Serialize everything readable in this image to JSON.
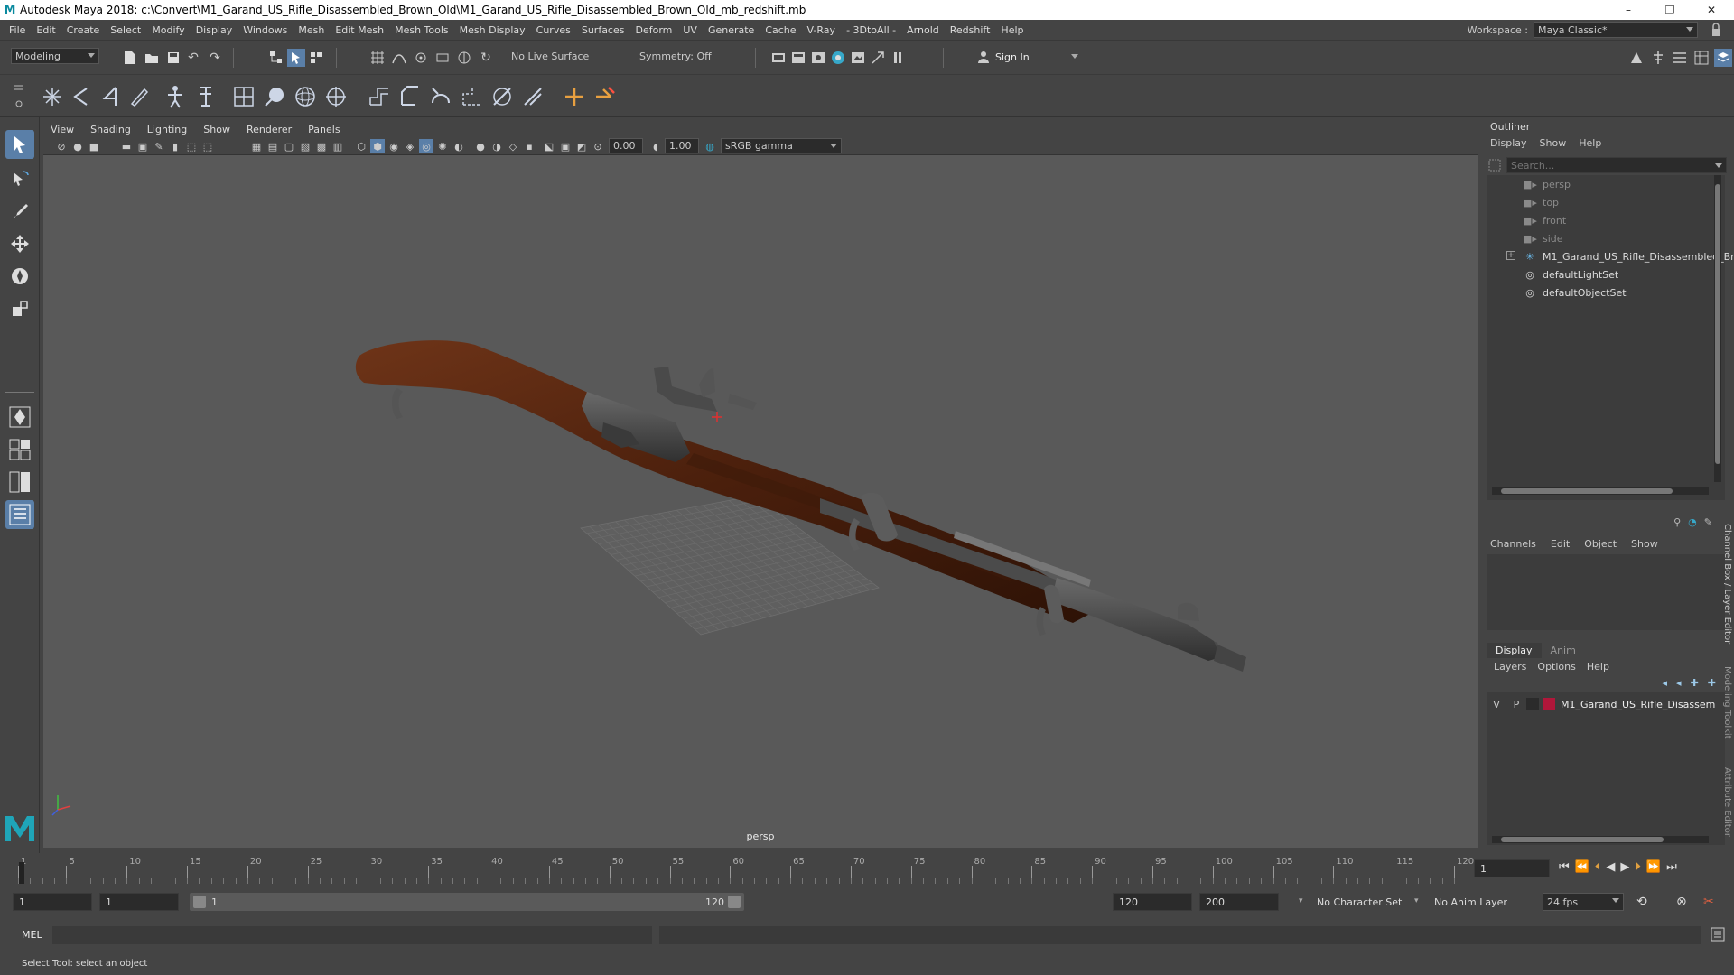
{
  "window": {
    "title": "Autodesk Maya 2018: c:\\Convert\\M1_Garand_US_Rifle_Disassembled_Brown_Old\\M1_Garand_US_Rifle_Disassembled_Brown_Old_mb_redshift.mb",
    "logo": "M",
    "controls": [
      "–",
      "❐",
      "✕"
    ]
  },
  "menubar": {
    "items": [
      "File",
      "Edit",
      "Create",
      "Select",
      "Modify",
      "Display",
      "Windows",
      "Mesh",
      "Edit Mesh",
      "Mesh Tools",
      "Mesh Display",
      "Curves",
      "Surfaces",
      "Deform",
      "UV",
      "Generate",
      "Cache",
      "V-Ray",
      "- 3DtoAll -",
      "Arnold",
      "Redshift",
      "Help"
    ],
    "workspace_label": "Workspace :",
    "workspace_value": "Maya Classic*"
  },
  "statusline": {
    "mode": "Modeling",
    "live_surface": "No Live Surface",
    "symmetry": "Symmetry: Off",
    "sign_in": "Sign In"
  },
  "viewport": {
    "menus": [
      "View",
      "Shading",
      "Lighting",
      "Show",
      "Renderer",
      "Panels"
    ],
    "exposure": "0.00",
    "gamma": "1.00",
    "color_space": "sRGB gamma",
    "camera_label": "persp"
  },
  "outliner": {
    "title": "Outliner",
    "menus": [
      "Display",
      "Show",
      "Help"
    ],
    "search_placeholder": "Search...",
    "items": [
      {
        "label": "persp",
        "icon": "camera-icon",
        "dim": true
      },
      {
        "label": "top",
        "icon": "camera-icon",
        "dim": true
      },
      {
        "label": "front",
        "icon": "camera-icon",
        "dim": true
      },
      {
        "label": "side",
        "icon": "camera-icon",
        "dim": true
      },
      {
        "label": "M1_Garand_US_Rifle_Disassembled_Bro",
        "icon": "group-icon",
        "dim": false
      },
      {
        "label": "defaultLightSet",
        "icon": "set-icon",
        "dim": false
      },
      {
        "label": "defaultObjectSet",
        "icon": "set-icon",
        "dim": false
      }
    ]
  },
  "channelbox": {
    "menus": [
      "Channels",
      "Edit",
      "Object",
      "Show"
    ]
  },
  "layers": {
    "tabs": [
      "Display",
      "Anim"
    ],
    "menus": [
      "Layers",
      "Options",
      "Help"
    ],
    "rows": [
      {
        "v": "V",
        "p": "P",
        "name": "M1_Garand_US_Rifle_Disassem",
        "color": "#b0173a"
      }
    ]
  },
  "side_tabs": [
    "Channel Box / Layer Editor",
    "Modeling Toolkit",
    "Attribute Editor"
  ],
  "timeline": {
    "ticks": [
      "1",
      "5",
      "10",
      "15",
      "20",
      "25",
      "30",
      "35",
      "40",
      "45",
      "50",
      "55",
      "60",
      "65",
      "70",
      "75",
      "80",
      "85",
      "90",
      "95",
      "100",
      "105",
      "110",
      "115",
      "120"
    ],
    "current_frame": "1"
  },
  "range": {
    "start": "1",
    "playback_start": "1",
    "slider_start": "1",
    "slider_end": "120",
    "playback_end": "120",
    "end": "200",
    "character_set": "No Character Set",
    "anim_layer": "No Anim Layer",
    "fps": "24 fps"
  },
  "cmdline": {
    "label": "MEL"
  },
  "helpline": {
    "text": "Select Tool: select an object"
  }
}
